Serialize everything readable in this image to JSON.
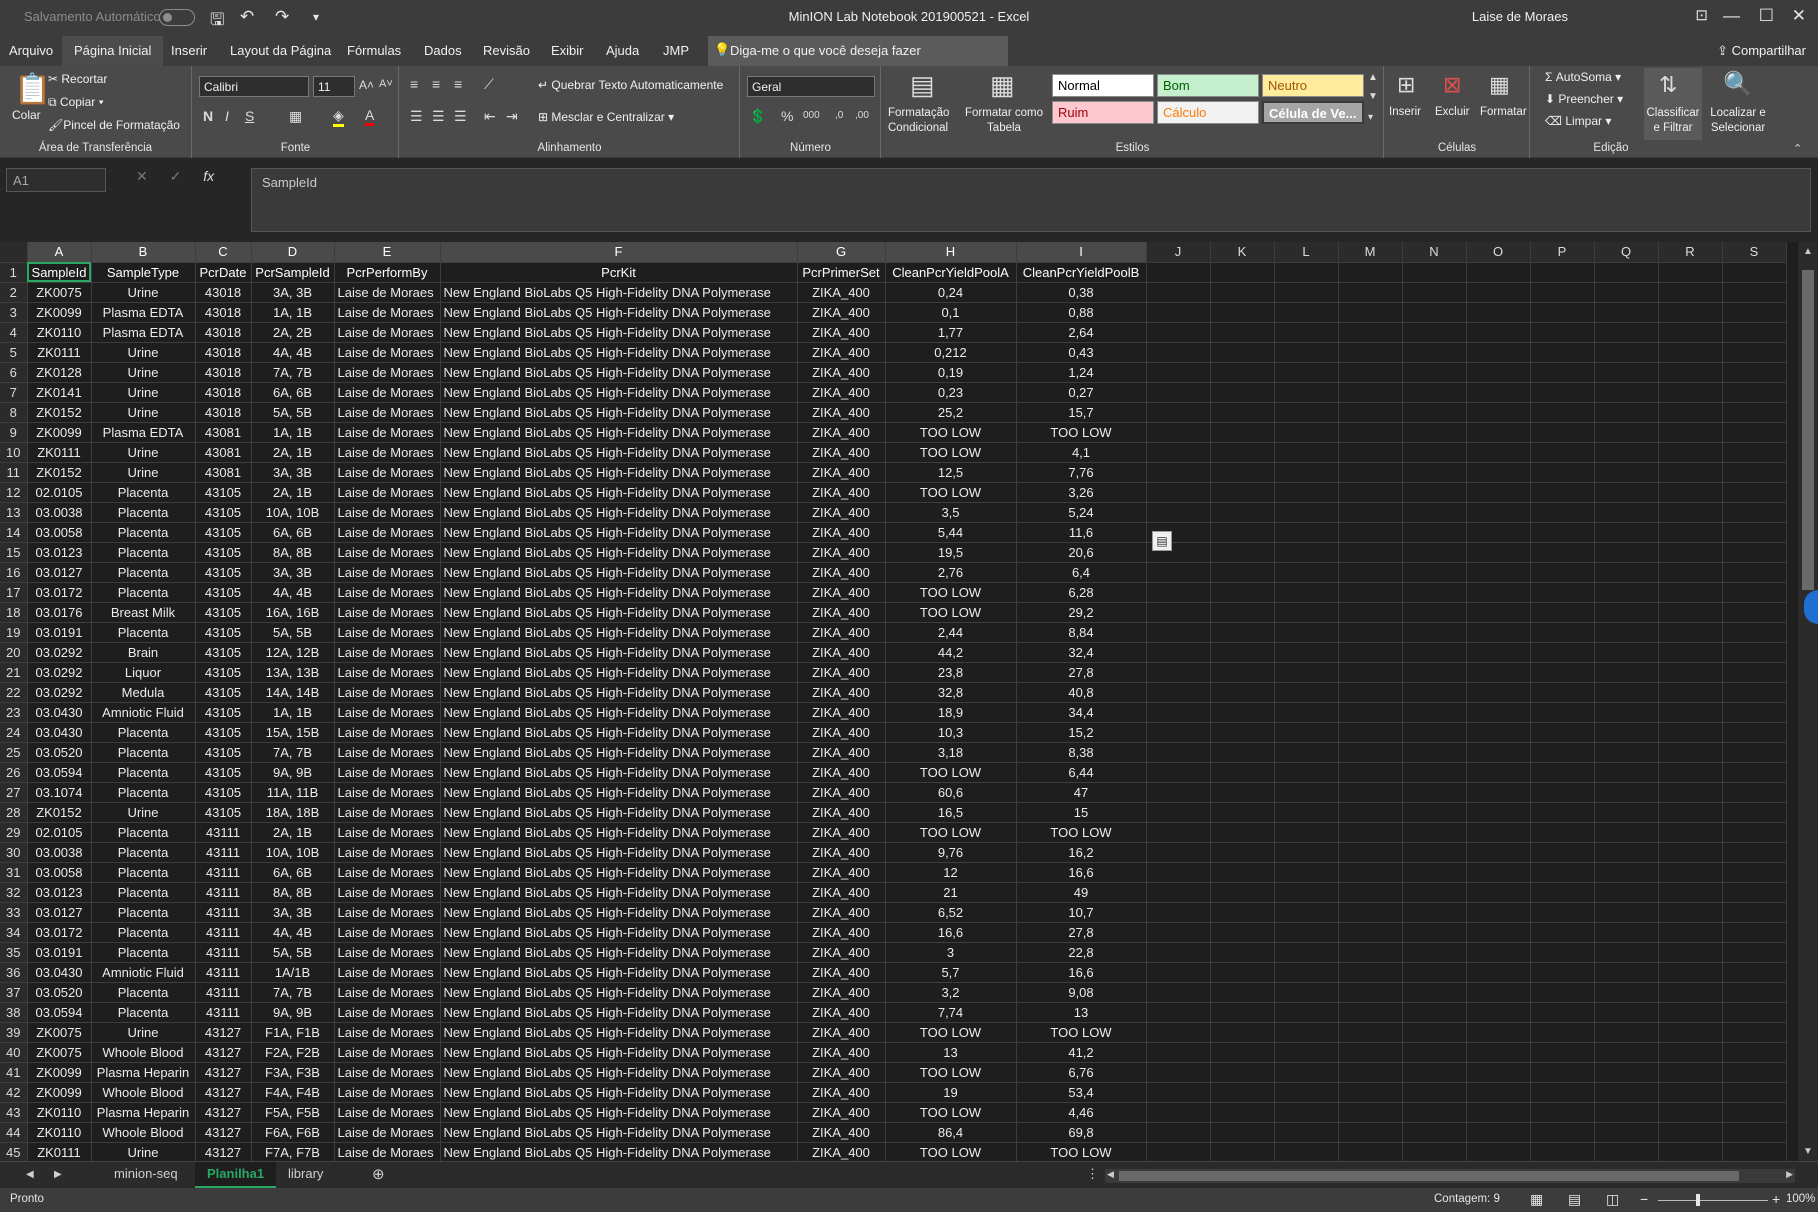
{
  "titlebar": {
    "autosave_label": "Salvamento Automático",
    "autosave_state": "off",
    "title": "MinION Lab Notebook 201900521  -  Excel",
    "user": "Laise de Moraes"
  },
  "ribbon_tabs": [
    "Arquivo",
    "Página Inicial",
    "Inserir",
    "Layout da Página",
    "Fórmulas",
    "Dados",
    "Revisão",
    "Exibir",
    "Ajuda",
    "JMP"
  ],
  "active_tab": "Página Inicial",
  "tell_me": "Diga-me o que você deseja fazer",
  "share": "Compartilhar",
  "ribbon": {
    "clipboard": {
      "paste": "Colar",
      "cut": "Recortar",
      "copy": "Copiar",
      "format_painter": "Pincel de Formatação",
      "label": "Área de Transferência"
    },
    "font": {
      "name": "Calibri",
      "size": "11",
      "label": "Fonte",
      "accent_fill": "#ffff00",
      "accent_text": "#ff0000"
    },
    "alignment": {
      "wrap": "Quebrar Texto Automaticamente",
      "merge": "Mesclar e Centralizar",
      "label": "Alinhamento"
    },
    "number": {
      "format": "Geral",
      "label": "Número"
    },
    "styles": {
      "conditional": "Formatação Condicional",
      "as_table": "Formatar como Tabela",
      "label": "Estilos",
      "cells": [
        {
          "name": "Normal",
          "bg": "#ffffff",
          "fg": "#000000"
        },
        {
          "name": "Bom",
          "bg": "#c6efce",
          "fg": "#006100"
        },
        {
          "name": "Neutro",
          "bg": "#ffeb9c",
          "fg": "#9c5700"
        },
        {
          "name": "Ruim",
          "bg": "#ffc7ce",
          "fg": "#9c0006"
        },
        {
          "name": "Cálculo",
          "bg": "#f2f2f2",
          "fg": "#fa7d00"
        },
        {
          "name": "Célula de Ve...",
          "bg": "#a5a5a5",
          "fg": "#ffffff"
        }
      ]
    },
    "cells": {
      "insert": "Inserir",
      "delete": "Excluir",
      "format": "Formatar",
      "label": "Células"
    },
    "editing": {
      "autosum": "AutoSoma",
      "fill": "Preencher",
      "clear": "Limpar",
      "sort": "Classificar e Filtrar",
      "find": "Localizar e Selecionar",
      "label": "Edição"
    }
  },
  "formula_bar": {
    "name_box": "A1",
    "formula": "SampleId"
  },
  "columns": [
    "A",
    "B",
    "C",
    "D",
    "E",
    "F",
    "G",
    "H",
    "I",
    "J",
    "K",
    "L",
    "M",
    "N",
    "O",
    "P",
    "Q",
    "R",
    "S"
  ],
  "rows": [
    [
      "SampleId",
      "SampleType",
      "PcrDate",
      "PcrSampleId",
      "PcrPerformBy",
      "PcrKit",
      "PcrPrimerSet",
      "CleanPcrYieldPoolA",
      "CleanPcrYieldPoolB"
    ],
    [
      "ZK0075",
      "Urine",
      "43018",
      "3A, 3B",
      "Laise de Moraes",
      "New England BioLabs Q5 High-Fidelity DNA Polymerase",
      "ZIKA_400",
      "0,24",
      "0,38"
    ],
    [
      "ZK0099",
      "Plasma EDTA",
      "43018",
      "1A, 1B",
      "Laise de Moraes",
      "New England BioLabs Q5 High-Fidelity DNA Polymerase",
      "ZIKA_400",
      "0,1",
      "0,88"
    ],
    [
      "ZK0110",
      "Plasma EDTA",
      "43018",
      "2A, 2B",
      "Laise de Moraes",
      "New England BioLabs Q5 High-Fidelity DNA Polymerase",
      "ZIKA_400",
      "1,77",
      "2,64"
    ],
    [
      "ZK0111",
      "Urine",
      "43018",
      "4A, 4B",
      "Laise de Moraes",
      "New England BioLabs Q5 High-Fidelity DNA Polymerase",
      "ZIKA_400",
      "0,212",
      "0,43"
    ],
    [
      "ZK0128",
      "Urine",
      "43018",
      "7A, 7B",
      "Laise de Moraes",
      "New England BioLabs Q5 High-Fidelity DNA Polymerase",
      "ZIKA_400",
      "0,19",
      "1,24"
    ],
    [
      "ZK0141",
      "Urine",
      "43018",
      "6A, 6B",
      "Laise de Moraes",
      "New England BioLabs Q5 High-Fidelity DNA Polymerase",
      "ZIKA_400",
      "0,23",
      "0,27"
    ],
    [
      "ZK0152",
      "Urine",
      "43018",
      "5A, 5B",
      "Laise de Moraes",
      "New England BioLabs Q5 High-Fidelity DNA Polymerase",
      "ZIKA_400",
      "25,2",
      "15,7"
    ],
    [
      "ZK0099",
      "Plasma EDTA",
      "43081",
      "1A, 1B",
      "Laise de Moraes",
      "New England BioLabs Q5 High-Fidelity DNA Polymerase",
      "ZIKA_400",
      "TOO LOW",
      "TOO LOW"
    ],
    [
      "ZK0111",
      "Urine",
      "43081",
      "2A, 1B",
      "Laise de Moraes",
      "New England BioLabs Q5 High-Fidelity DNA Polymerase",
      "ZIKA_400",
      "TOO LOW",
      "4,1"
    ],
    [
      "ZK0152",
      "Urine",
      "43081",
      "3A, 3B",
      "Laise de Moraes",
      "New England BioLabs Q5 High-Fidelity DNA Polymerase",
      "ZIKA_400",
      "12,5",
      "7,76"
    ],
    [
      "02.0105",
      "Placenta",
      "43105",
      "2A, 1B",
      "Laise de Moraes",
      "New England BioLabs Q5 High-Fidelity DNA Polymerase",
      "ZIKA_400",
      "TOO LOW",
      "3,26"
    ],
    [
      "03.0038",
      "Placenta",
      "43105",
      "10A, 10B",
      "Laise de Moraes",
      "New England BioLabs Q5 High-Fidelity DNA Polymerase",
      "ZIKA_400",
      "3,5",
      "5,24"
    ],
    [
      "03.0058",
      "Placenta",
      "43105",
      "6A, 6B",
      "Laise de Moraes",
      "New England BioLabs Q5 High-Fidelity DNA Polymerase",
      "ZIKA_400",
      "5,44",
      "11,6"
    ],
    [
      "03.0123",
      "Placenta",
      "43105",
      "8A, 8B",
      "Laise de Moraes",
      "New England BioLabs Q5 High-Fidelity DNA Polymerase",
      "ZIKA_400",
      "19,5",
      "20,6"
    ],
    [
      "03.0127",
      "Placenta",
      "43105",
      "3A, 3B",
      "Laise de Moraes",
      "New England BioLabs Q5 High-Fidelity DNA Polymerase",
      "ZIKA_400",
      "2,76",
      "6,4"
    ],
    [
      "03.0172",
      "Placenta",
      "43105",
      "4A, 4B",
      "Laise de Moraes",
      "New England BioLabs Q5 High-Fidelity DNA Polymerase",
      "ZIKA_400",
      "TOO LOW",
      "6,28"
    ],
    [
      "03.0176",
      "Breast Milk",
      "43105",
      "16A, 16B",
      "Laise de Moraes",
      "New England BioLabs Q5 High-Fidelity DNA Polymerase",
      "ZIKA_400",
      "TOO LOW",
      "29,2"
    ],
    [
      "03.0191",
      "Placenta",
      "43105",
      "5A, 5B",
      "Laise de Moraes",
      "New England BioLabs Q5 High-Fidelity DNA Polymerase",
      "ZIKA_400",
      "2,44",
      "8,84"
    ],
    [
      "03.0292",
      "Brain",
      "43105",
      "12A, 12B",
      "Laise de Moraes",
      "New England BioLabs Q5 High-Fidelity DNA Polymerase",
      "ZIKA_400",
      "44,2",
      "32,4"
    ],
    [
      "03.0292",
      "Liquor",
      "43105",
      "13A, 13B",
      "Laise de Moraes",
      "New England BioLabs Q5 High-Fidelity DNA Polymerase",
      "ZIKA_400",
      "23,8",
      "27,8"
    ],
    [
      "03.0292",
      "Medula",
      "43105",
      "14A, 14B",
      "Laise de Moraes",
      "New England BioLabs Q5 High-Fidelity DNA Polymerase",
      "ZIKA_400",
      "32,8",
      "40,8"
    ],
    [
      "03.0430",
      "Amniotic Fluid",
      "43105",
      "1A, 1B",
      "Laise de Moraes",
      "New England BioLabs Q5 High-Fidelity DNA Polymerase",
      "ZIKA_400",
      "18,9",
      "34,4"
    ],
    [
      "03.0430",
      "Placenta",
      "43105",
      "15A, 15B",
      "Laise de Moraes",
      "New England BioLabs Q5 High-Fidelity DNA Polymerase",
      "ZIKA_400",
      "10,3",
      "15,2"
    ],
    [
      "03.0520",
      "Placenta",
      "43105",
      "7A, 7B",
      "Laise de Moraes",
      "New England BioLabs Q5 High-Fidelity DNA Polymerase",
      "ZIKA_400",
      "3,18",
      "8,38"
    ],
    [
      "03.0594",
      "Placenta",
      "43105",
      "9A, 9B",
      "Laise de Moraes",
      "New England BioLabs Q5 High-Fidelity DNA Polymerase",
      "ZIKA_400",
      "TOO LOW",
      "6,44"
    ],
    [
      "03.1074",
      "Placenta",
      "43105",
      "11A, 11B",
      "Laise de Moraes",
      "New England BioLabs Q5 High-Fidelity DNA Polymerase",
      "ZIKA_400",
      "60,6",
      "47"
    ],
    [
      "ZK0152",
      "Urine",
      "43105",
      "18A, 18B",
      "Laise de Moraes",
      "New England BioLabs Q5 High-Fidelity DNA Polymerase",
      "ZIKA_400",
      "16,5",
      "15"
    ],
    [
      "02.0105",
      "Placenta",
      "43111",
      "2A, 1B",
      "Laise de Moraes",
      "New England BioLabs Q5 High-Fidelity DNA Polymerase",
      "ZIKA_400",
      "TOO LOW",
      "TOO LOW"
    ],
    [
      "03.0038",
      "Placenta",
      "43111",
      "10A, 10B",
      "Laise de Moraes",
      "New England BioLabs Q5 High-Fidelity DNA Polymerase",
      "ZIKA_400",
      "9,76",
      "16,2"
    ],
    [
      "03.0058",
      "Placenta",
      "43111",
      "6A, 6B",
      "Laise de Moraes",
      "New England BioLabs Q5 High-Fidelity DNA Polymerase",
      "ZIKA_400",
      "12",
      "16,6"
    ],
    [
      "03.0123",
      "Placenta",
      "43111",
      "8A, 8B",
      "Laise de Moraes",
      "New England BioLabs Q5 High-Fidelity DNA Polymerase",
      "ZIKA_400",
      "21",
      "49"
    ],
    [
      "03.0127",
      "Placenta",
      "43111",
      "3A, 3B",
      "Laise de Moraes",
      "New England BioLabs Q5 High-Fidelity DNA Polymerase",
      "ZIKA_400",
      "6,52",
      "10,7"
    ],
    [
      "03.0172",
      "Placenta",
      "43111",
      "4A, 4B",
      "Laise de Moraes",
      "New England BioLabs Q5 High-Fidelity DNA Polymerase",
      "ZIKA_400",
      "16,6",
      "27,8"
    ],
    [
      "03.0191",
      "Placenta",
      "43111",
      "5A, 5B",
      "Laise de Moraes",
      "New England BioLabs Q5 High-Fidelity DNA Polymerase",
      "ZIKA_400",
      "3",
      "22,8"
    ],
    [
      "03.0430",
      "Amniotic Fluid",
      "43111",
      "1A/1B",
      "Laise de Moraes",
      "New England BioLabs Q5 High-Fidelity DNA Polymerase",
      "ZIKA_400",
      "5,7",
      "16,6"
    ],
    [
      "03.0520",
      "Placenta",
      "43111",
      "7A, 7B",
      "Laise de Moraes",
      "New England BioLabs Q5 High-Fidelity DNA Polymerase",
      "ZIKA_400",
      "3,2",
      "9,08"
    ],
    [
      "03.0594",
      "Placenta",
      "43111",
      "9A, 9B",
      "Laise de Moraes",
      "New England BioLabs Q5 High-Fidelity DNA Polymerase",
      "ZIKA_400",
      "7,74",
      "13"
    ],
    [
      "ZK0075",
      "Urine",
      "43127",
      "F1A, F1B",
      "Laise de Moraes",
      "New England BioLabs Q5 High-Fidelity DNA Polymerase",
      "ZIKA_400",
      "TOO LOW",
      "TOO LOW"
    ],
    [
      "ZK0075",
      "Whoole Blood",
      "43127",
      "F2A, F2B",
      "Laise de Moraes",
      "New England BioLabs Q5 High-Fidelity DNA Polymerase",
      "ZIKA_400",
      "13",
      "41,2"
    ],
    [
      "ZK0099",
      "Plasma Heparin",
      "43127",
      "F3A, F3B",
      "Laise de Moraes",
      "New England BioLabs Q5 High-Fidelity DNA Polymerase",
      "ZIKA_400",
      "TOO LOW",
      "6,76"
    ],
    [
      "ZK0099",
      "Whoole Blood",
      "43127",
      "F4A, F4B",
      "Laise de Moraes",
      "New England BioLabs Q5 High-Fidelity DNA Polymerase",
      "ZIKA_400",
      "19",
      "53,4"
    ],
    [
      "ZK0110",
      "Plasma Heparin",
      "43127",
      "F5A, F5B",
      "Laise de Moraes",
      "New England BioLabs Q5 High-Fidelity DNA Polymerase",
      "ZIKA_400",
      "TOO LOW",
      "4,46"
    ],
    [
      "ZK0110",
      "Whoole Blood",
      "43127",
      "F6A, F6B",
      "Laise de Moraes",
      "New England BioLabs Q5 High-Fidelity DNA Polymerase",
      "ZIKA_400",
      "86,4",
      "69,8"
    ],
    [
      "ZK0111",
      "Urine",
      "43127",
      "F7A, F7B",
      "Laise de Moraes",
      "New England BioLabs Q5 High-Fidelity DNA Polymerase",
      "ZIKA_400",
      "TOO LOW",
      "TOO LOW"
    ]
  ],
  "sheets": [
    "minion-seq",
    "Planilha1",
    "library"
  ],
  "active_sheet": "Planilha1",
  "status": {
    "ready": "Pronto",
    "count": "Contagem: 9",
    "zoom": "100%"
  }
}
